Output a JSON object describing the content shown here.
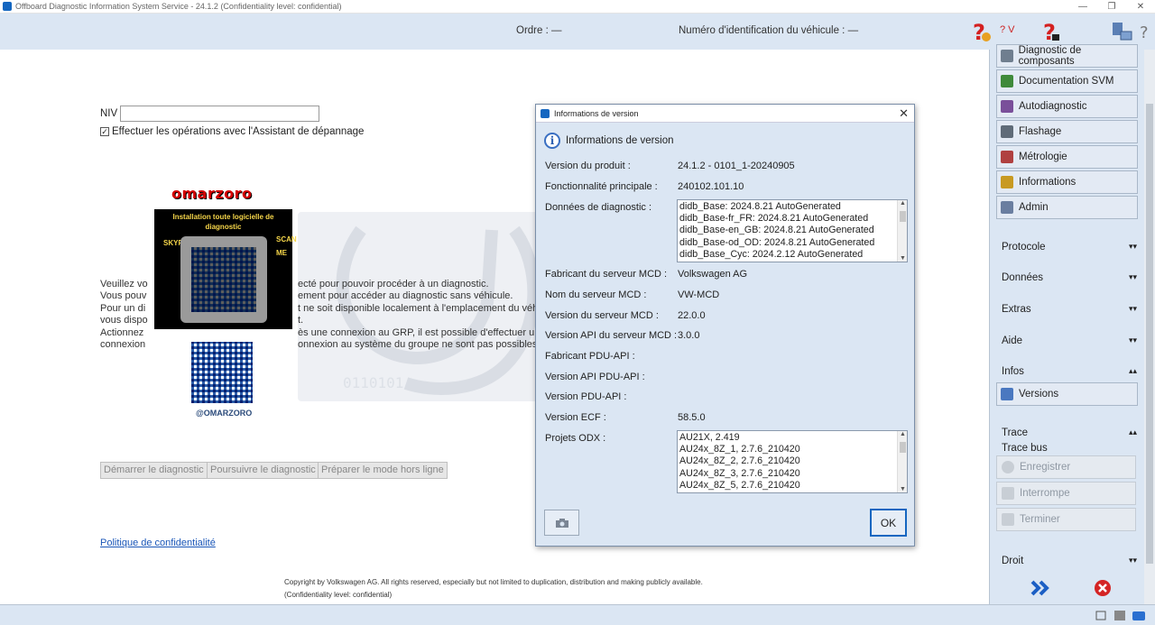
{
  "window": {
    "title": "Offboard Diagnostic Information System Service - 24.1.2 (Confidentiality level: confidential)",
    "controls": {
      "minimize": "—",
      "restore": "❐",
      "close": "✕"
    }
  },
  "header": {
    "ordre": "Ordre :   —",
    "vin": "Numéro d'identification du véhicule :   —",
    "help_text": "? V"
  },
  "main": {
    "niv_label": "NIV",
    "niv_value": "",
    "checkbox_label": "Effectuer les opérations avec l'Assistant de dépannage",
    "checkbox_checked": true,
    "info_left": "Veuillez vo\nVous pouv\nPour un di\nvous dispo\nActionnez\nconnexion",
    "info_right": "ecté pour pouvoir procéder à un diagnostic.\nement pour accéder au diagnostic sans véhicule.\nt ne soit disponible localement à l'emplacement du véhic\nt.\nès une connexion au GRP, il est possible d'effectuer un\nonnexion au système du groupe ne sont pas possibles.",
    "overlay": {
      "title": "omarzoro",
      "box_text": "Installation toute logicielle de\ndiagnostic",
      "left_vertical": "SKYPE",
      "right_vertical": "SCAN ME",
      "handle": "@OMARZORO"
    },
    "buttons": {
      "start": "Démarrer le diagnostic",
      "continue": "Poursuivre le diagnostic",
      "offline": "Préparer le mode hors ligne"
    },
    "privacy_link": "Politique de confidentialité",
    "copyright_line1": "Copyright by Volkswagen AG. All rights reserved, especially but not limited to duplication, distribution and making publicly available.",
    "copyright_line2": "(Confidentiality level: confidential)"
  },
  "sidebar": {
    "nav": [
      {
        "label": "Diagnostic de composants",
        "icon": "component-diagnostic-icon",
        "color": "#6f7e8f"
      },
      {
        "label": "Documentation SVM",
        "icon": "svm-doc-icon",
        "color": "#3f8a3a"
      },
      {
        "label": "Autodiagnostic",
        "icon": "self-diagnostic-icon",
        "color": "#7a4f9a"
      },
      {
        "label": "Flashage",
        "icon": "flash-icon",
        "color": "#5f6b78"
      },
      {
        "label": "Métrologie",
        "icon": "metrology-icon",
        "color": "#b04040"
      },
      {
        "label": "Informations",
        "icon": "info-books-icon",
        "color": "#c89a22"
      },
      {
        "label": "Admin",
        "icon": "admin-icon",
        "color": "#6a7ea0"
      }
    ],
    "sections": {
      "protocole": "Protocole",
      "donnees": "Données",
      "extras": "Extras",
      "aide": "Aide",
      "infos": "Infos",
      "trace": "Trace",
      "droit": "Droit"
    },
    "versions_btn": "Versions",
    "trace_bus": "Trace bus",
    "trace_buttons": [
      "Enregistrer",
      "Interrompe",
      "Terminer"
    ],
    "forward_icon": "double-chevron-right-icon",
    "exit_icon": "close-red-icon"
  },
  "dialog": {
    "title": "Informations de version",
    "heading": "Informations de version",
    "fields": {
      "product_version_label": "Version du produit :",
      "product_version": "24.1.2 - 0101_1-20240905",
      "main_function_label": "Fonctionnalité principale :",
      "main_function": "240102.101.10",
      "diag_data_label": "Données de diagnostic :",
      "diag_data": [
        "didb_Base: 2024.8.21 AutoGenerated",
        "didb_Base-fr_FR: 2024.8.21 AutoGenerated",
        "didb_Base-en_GB: 2024.8.21 AutoGenerated",
        "didb_Base-od_OD: 2024.8.21 AutoGenerated",
        "didb_Base_Cyc: 2024.2.12 AutoGenerated"
      ],
      "mcd_maker_label": "Fabricant du serveur MCD :",
      "mcd_maker": "Volkswagen AG",
      "mcd_name_label": "Nom du serveur MCD :",
      "mcd_name": "VW-MCD",
      "mcd_version_label": "Version du serveur MCD :",
      "mcd_version": "22.0.0",
      "mcd_api_label": "Version API du serveur MCD :",
      "mcd_api": "3.0.0",
      "pdu_maker_label": "Fabricant PDU-API :",
      "pdu_api_label": "Version API PDU-API :",
      "pdu_version_label": "Version PDU-API :",
      "ecf_label": "Version ECF :",
      "ecf": "58.5.0",
      "odx_label": "Projets ODX :",
      "odx": [
        "AU21X, 2.419",
        "AU24x_8Z_1, 2.7.6_210420",
        "AU24x_8Z_2, 2.7.6_210420",
        "AU24x_8Z_3, 2.7.6_210420",
        "AU24x_8Z_5, 2.7.6_210420"
      ]
    },
    "ok": "OK"
  }
}
